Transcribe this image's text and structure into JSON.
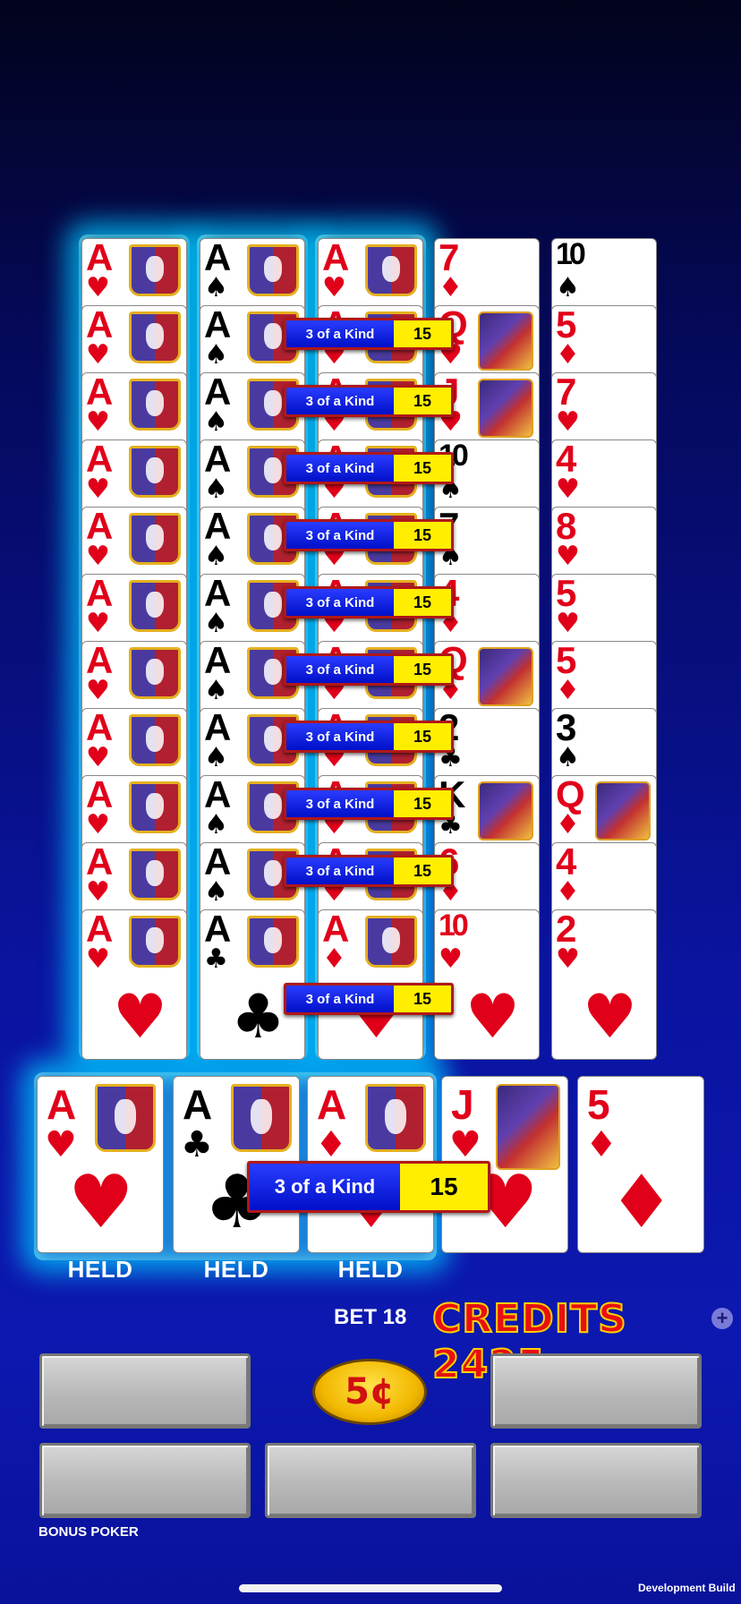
{
  "small_hands": [
    [
      "A♥",
      "A♠",
      "A♥",
      "7♦",
      "10♠"
    ],
    [
      "A♥",
      "A♠",
      "A♥",
      "Q♥",
      "5♦"
    ],
    [
      "A♥",
      "A♠",
      "A♥",
      "J♥",
      "7♥"
    ],
    [
      "A♥",
      "A♠",
      "A♥",
      "10♠",
      "4♥"
    ],
    [
      "A♥",
      "A♠",
      "A♥",
      "7♠",
      "8♥"
    ],
    [
      "A♥",
      "A♠",
      "A♥",
      "4♦",
      "5♥"
    ],
    [
      "A♥",
      "A♠",
      "A♥",
      "Q♦",
      "5♦"
    ],
    [
      "A♥",
      "A♠",
      "A♥",
      "2♣",
      "3♠"
    ],
    [
      "A♥",
      "A♠",
      "A♥",
      "K♣",
      "Q♦"
    ],
    [
      "A♥",
      "A♠",
      "A♥",
      "6♦",
      "4♦"
    ],
    [
      "A♥",
      "A♣",
      "A♦",
      "10♥",
      "2♥"
    ]
  ],
  "win_label": "3 of a Kind",
  "win_value": "15",
  "main_hand": [
    {
      "rank": "A",
      "suit": "♥",
      "color": "#e1001a"
    },
    {
      "rank": "A",
      "suit": "♣",
      "color": "#000000"
    },
    {
      "rank": "A",
      "suit": "♦",
      "color": "#e1001a"
    },
    {
      "rank": "J",
      "suit": "♥",
      "color": "#e1001a"
    },
    {
      "rank": "5",
      "suit": "♦",
      "color": "#e1001a"
    }
  ],
  "main_win": {
    "label": "3 of a Kind",
    "value": "15"
  },
  "held_label": "HELD",
  "bet_text": "BET 18",
  "credits_text": "CREDITS 2425",
  "plus_icon": "plus-circle-icon",
  "denomination": "5¢",
  "game_name": "BONUS POKER",
  "build_label": "Development Build"
}
